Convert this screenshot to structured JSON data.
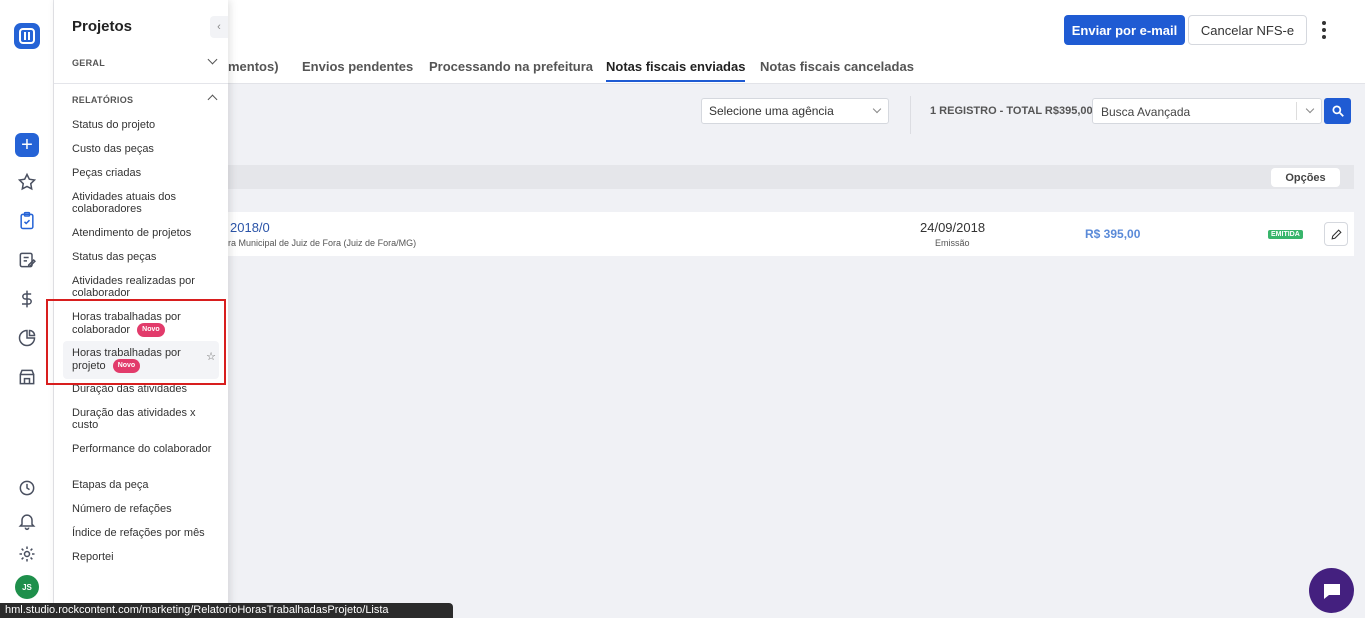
{
  "header": {
    "email_button": "Enviar por e-mail",
    "cancel_button": "Cancelar NFS-e"
  },
  "tabs": [
    {
      "label": "mentos)"
    },
    {
      "label": "Envios pendentes"
    },
    {
      "label": "Processando na prefeitura"
    },
    {
      "label": "Notas fiscais enviadas",
      "active": true
    },
    {
      "label": "Notas fiscais canceladas"
    }
  ],
  "filters": {
    "agency_select": "Selecione uma agência",
    "totals": "1 REGISTRO - TOTAL R$395,00",
    "advanced_search": "Busca Avançada"
  },
  "table": {
    "options_label": "Opções",
    "rows": [
      {
        "number": "2018/0",
        "location": "ra Municipal de Juiz de Fora (Juiz de Fora/MG)",
        "date": "24/09/2018",
        "date_label": "Emissão",
        "amount": "R$ 395,00",
        "status": "EMITIDA"
      }
    ]
  },
  "panel": {
    "title": "Projetos",
    "section_general": "GERAL",
    "section_reports": "RELATÓRIOS",
    "new_badge": "Novo",
    "items": [
      {
        "label": "Status do projeto"
      },
      {
        "label": "Custo das peças"
      },
      {
        "label": "Peças criadas"
      },
      {
        "label": "Atividades atuais dos colaboradores"
      },
      {
        "label": "Atendimento de projetos"
      },
      {
        "label": "Status das peças"
      },
      {
        "label": "Atividades realizadas por colaborador"
      },
      {
        "label": "Horas trabalhadas por colaborador"
      },
      {
        "label": "Horas trabalhadas por projeto"
      },
      {
        "label": "Duração das atividades"
      },
      {
        "label": "Duração das atividades x custo"
      },
      {
        "label": "Performance do colaborador"
      },
      {
        "label": "Etapas da peça"
      },
      {
        "label": "Número de refações"
      },
      {
        "label": "Índice de refações por mês"
      },
      {
        "label": "Reportei"
      }
    ]
  },
  "user": {
    "initials": "JS"
  },
  "status_url": "hml.studio.rockcontent.com/marketing/RelatorioHorasTrabalhadasProjeto/Lista",
  "colors": {
    "primary": "#1f5bd3",
    "badge_new": "#e23b6b",
    "status_ok": "#38b56b",
    "highlight_box": "#d81e1e"
  },
  "icons": [
    "app-logo-icon",
    "plus-icon",
    "star-icon",
    "clipboard-icon",
    "edit-list-icon",
    "dollar-icon",
    "pie-chart-icon",
    "store-icon",
    "clock-icon",
    "bell-icon",
    "gear-icon",
    "search-icon",
    "pencil-icon",
    "chat-icon"
  ]
}
